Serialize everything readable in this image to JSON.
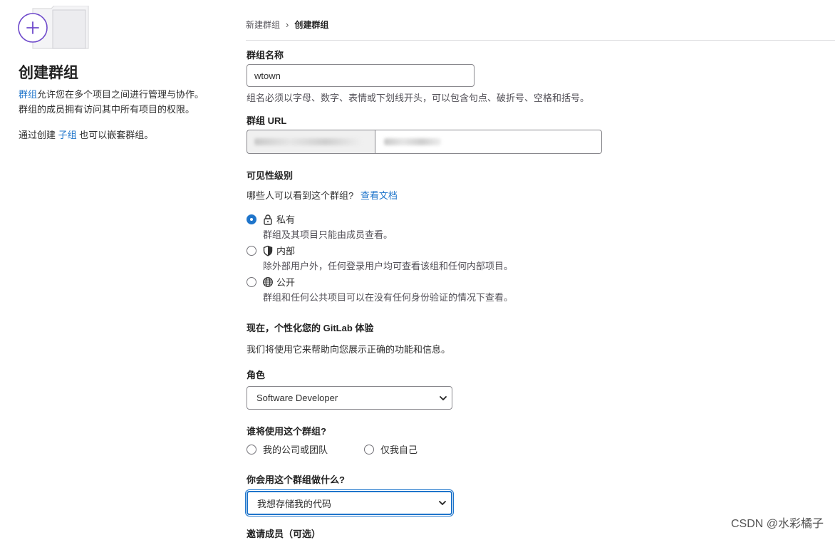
{
  "sidebar": {
    "title": "创建群组",
    "desc_link": "群组",
    "desc_rest": "允许您在多个项目之间进行管理与协作。",
    "desc_line2": "群组的成员拥有访问其中所有项目的权限。",
    "sub_prefix": "通过创建",
    "sub_link": "子组",
    "sub_suffix": "也可以嵌套群组。"
  },
  "breadcrumb": {
    "parent": "新建群组",
    "separator": "›",
    "current": "创建群组"
  },
  "form": {
    "group_name": {
      "label": "群组名称",
      "value": "wtown",
      "help": "组名必须以字母、数字、表情或下划线开头，可以包含句点、破折号、空格和括号。"
    },
    "group_url": {
      "label": "群组 URL"
    },
    "visibility": {
      "label": "可见性级别",
      "question": "哪些人可以看到这个群组?",
      "docs_link": "查看文档",
      "options": [
        {
          "label": "私有",
          "icon": "lock-icon",
          "description": "群组及其项目只能由成员查看。",
          "checked": true
        },
        {
          "label": "内部",
          "icon": "shield-icon",
          "description": "除外部用户外，任何登录用户均可查看该组和任何内部项目。",
          "checked": false
        },
        {
          "label": "公开",
          "icon": "globe-icon",
          "description": "群组和任何公共项目可以在没有任何身份验证的情况下查看。",
          "checked": false
        }
      ]
    },
    "personalize": {
      "title": "现在，个性化您的 GitLab 体验",
      "description": "我们将使用它来帮助向您展示正确的功能和信息。"
    },
    "role": {
      "label": "角色",
      "selected": "Software Developer"
    },
    "who": {
      "label": "谁将使用这个群组?",
      "options": [
        {
          "label": "我的公司或团队",
          "checked": false
        },
        {
          "label": "仅我自己",
          "checked": false
        }
      ]
    },
    "purpose": {
      "label": "你会用这个群组做什么?",
      "selected": "我想存储我的代码"
    },
    "invite": {
      "label": "邀请成员（可选）"
    }
  },
  "watermark": "CSDN @水彩橘子",
  "colors": {
    "accent": "#1f75cb",
    "illustration_purple": "#6e49cb",
    "illustration_fill": "#ececef"
  }
}
